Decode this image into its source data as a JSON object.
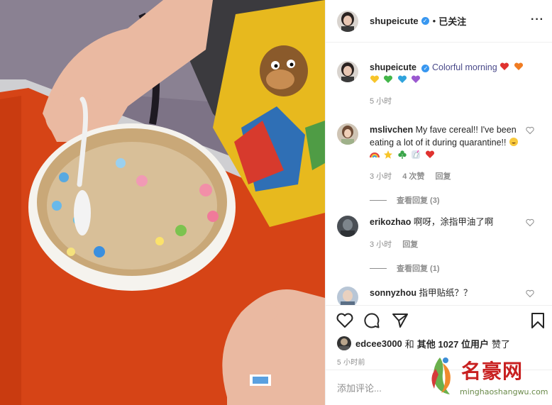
{
  "post": {
    "author": "shupeicute",
    "follow_state": "已关注",
    "separator": "•",
    "more_icon": "more-horizontal-icon",
    "verified_icon": "verified-badge-icon"
  },
  "caption": {
    "username": "shupeicute",
    "text": "Colorful morning",
    "emojis": [
      "red-heart",
      "orange-heart",
      "yellow-heart",
      "green-heart",
      "blue-heart",
      "purple-heart"
    ],
    "time": "5 小时"
  },
  "comments": [
    {
      "username": "mslivchen",
      "text": "My fave cereal!! I've been eating a lot of it during quarantine!!",
      "emojis": [
        "grinning-face",
        "rainbow",
        "star",
        "shamrock",
        "unicorn",
        "red-heart"
      ],
      "time": "3 小时",
      "likes": "4 次赞",
      "reply": "回复",
      "view_replies": "查看回复 (3)"
    },
    {
      "username": "erikozhao",
      "text": "啊呀，涂指甲油了啊",
      "time": "3 小时",
      "reply": "回复",
      "view_replies": "查看回复 (1)"
    },
    {
      "username": "sonnyzhou",
      "text": "指甲贴纸？？"
    }
  ],
  "actions": {
    "icons": [
      "heart-icon",
      "comment-icon",
      "share-icon",
      "bookmark-icon"
    ]
  },
  "likes": {
    "first_user": "edcee3000",
    "and_text": "和",
    "others_prefix": "其他 1027 位用户",
    "suffix": "赞了"
  },
  "time_ago": "5 小时前",
  "add_comment": {
    "placeholder": "添加评论..."
  },
  "watermark": {
    "title": "名豪网",
    "url": "minghaoshangwu.com"
  },
  "colors": {
    "table_orange": "#d64416",
    "verified_blue": "#3897f0",
    "muted_text": "#8e8e8e",
    "watermark_red": "#c82020"
  }
}
